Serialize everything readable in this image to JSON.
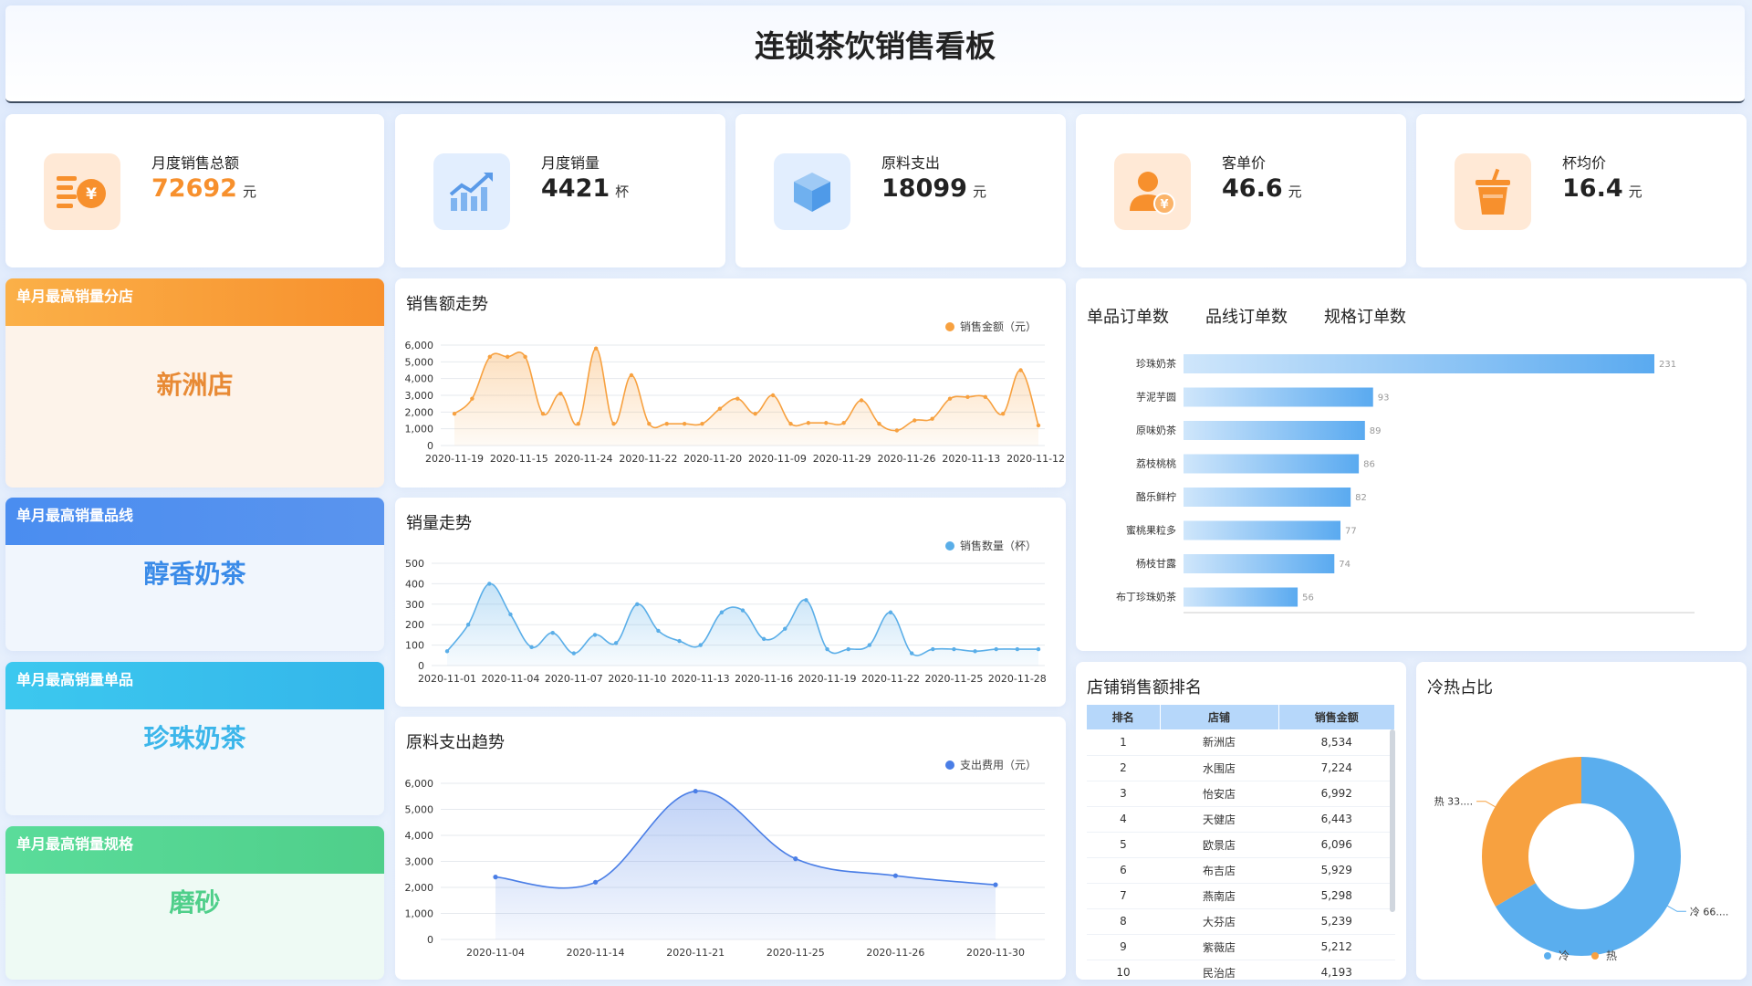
{
  "title": "连锁茶饮销售看板",
  "kpis": [
    {
      "label": "月度销售总额",
      "value": "72692",
      "unit": "元",
      "icon": "money-stack-icon",
      "color": "#f7902d"
    },
    {
      "label": "月度销量",
      "value": "4421",
      "unit": "杯",
      "icon": "chart-growth-icon",
      "color": "#5aa0ef"
    },
    {
      "label": "原料支出",
      "value": "18099",
      "unit": "元",
      "icon": "box-icon",
      "color": "#5aa0ef"
    },
    {
      "label": "客单价",
      "value": "46.6",
      "unit": "元",
      "icon": "customer-yuan-icon",
      "color": "#f7902d"
    },
    {
      "label": "杯均价",
      "value": "16.4",
      "unit": "元",
      "icon": "cup-icon",
      "color": "#f7902d"
    }
  ],
  "highlights": [
    {
      "label": "单月最高销量分店",
      "value": "新洲店",
      "color": "#f7902d"
    },
    {
      "label": "单月最高销量品线",
      "value": "醇香奶茶",
      "color": "#3a8be8"
    },
    {
      "label": "单月最高销量单品",
      "value": "珍珠奶茶",
      "color": "#3cb6ea"
    },
    {
      "label": "单月最高销量规格",
      "value": "磨砂",
      "color": "#4fcf8a"
    }
  ],
  "charts": {
    "sales_amount": {
      "title": "销售额走势",
      "legend": "销售金额（元）"
    },
    "sales_volume": {
      "title": "销量走势",
      "legend": "销售数量（杯）"
    },
    "material_cost": {
      "title": "原料支出趋势",
      "legend": "支出费用（元）"
    },
    "orders": {
      "tabs": [
        "单品订单数",
        "品线订单数",
        "规格订单数"
      ]
    },
    "store_rank": {
      "title": "店铺销售额排名",
      "headers": [
        "排名",
        "店铺",
        "销售金额"
      ]
    },
    "hot_cold": {
      "title": "冷热占比",
      "labels": {
        "hot": "热 33....",
        "cold": "冷 66...."
      },
      "legend": [
        "冷",
        "热"
      ]
    }
  },
  "chart_data": [
    {
      "type": "area",
      "title": "销售额走势",
      "series": [
        {
          "name": "销售金额（元）",
          "color": "#f7a140",
          "values": [
            1900,
            2800,
            5300,
            5300,
            5300,
            1900,
            3100,
            1300,
            5800,
            1300,
            4200,
            1300,
            1300,
            1300,
            1300,
            2200,
            2800,
            1900,
            3000,
            1300,
            1350,
            1350,
            1350,
            2700,
            1300,
            900,
            1500,
            1600,
            2800,
            2900,
            2900,
            1900,
            4500,
            1200
          ]
        }
      ],
      "x_ticks": [
        "2020-11-19",
        "2020-11-15",
        "2020-11-24",
        "2020-11-22",
        "2020-11-20",
        "2020-11-09",
        "2020-11-29",
        "2020-11-26",
        "2020-11-13",
        "2020-11-12"
      ],
      "y_ticks": [
        "6,000",
        "5,000",
        "4,000",
        "3,000",
        "2,000",
        "1,000",
        "0"
      ],
      "ylim": [
        0,
        6000
      ]
    },
    {
      "type": "area",
      "title": "销量走势",
      "series": [
        {
          "name": "销售数量（杯）",
          "color": "#5aaee8",
          "values": [
            70,
            200,
            400,
            250,
            90,
            160,
            60,
            150,
            110,
            300,
            170,
            120,
            100,
            260,
            270,
            130,
            180,
            320,
            80,
            80,
            100,
            260,
            60,
            80,
            80,
            70,
            80,
            80,
            80
          ]
        }
      ],
      "x_ticks": [
        "2020-11-01",
        "2020-11-04",
        "2020-11-07",
        "2020-11-10",
        "2020-11-13",
        "2020-11-16",
        "2020-11-19",
        "2020-11-22",
        "2020-11-25",
        "2020-11-28"
      ],
      "y_ticks": [
        "500",
        "400",
        "300",
        "200",
        "100",
        "0"
      ],
      "ylim": [
        0,
        500
      ]
    },
    {
      "type": "area",
      "title": "原料支出趋势",
      "categories": [
        "2020-11-04",
        "2020-11-14",
        "2020-11-21",
        "2020-11-25",
        "2020-11-26",
        "2020-11-30"
      ],
      "series": [
        {
          "name": "支出费用（元）",
          "color": "#4a7ee6",
          "values": [
            2400,
            2200,
            5700,
            3100,
            2450,
            2100
          ]
        }
      ],
      "y_ticks": [
        "6,000",
        "5,000",
        "4,000",
        "3,000",
        "2,000",
        "1,000",
        "0"
      ],
      "ylim": [
        0,
        6000
      ]
    },
    {
      "type": "bar",
      "title": "单品订单数",
      "categories": [
        "珍珠奶茶",
        "芋泥芋圆",
        "原味奶茶",
        "荔枝桃桃",
        "酪乐鲜柠",
        "蜜桃果粒多",
        "杨枝甘露",
        "布丁珍珠奶茶"
      ],
      "values": [
        231,
        93,
        89,
        86,
        82,
        77,
        74,
        56
      ],
      "xlim": [
        0,
        250
      ]
    },
    {
      "type": "table",
      "title": "店铺销售额排名",
      "headers": [
        "排名",
        "店铺",
        "销售金额"
      ],
      "rows": [
        [
          "1",
          "新洲店",
          "8,534"
        ],
        [
          "2",
          "水围店",
          "7,224"
        ],
        [
          "3",
          "怡安店",
          "6,992"
        ],
        [
          "4",
          "天健店",
          "6,443"
        ],
        [
          "5",
          "欧景店",
          "6,096"
        ],
        [
          "6",
          "布吉店",
          "5,929"
        ],
        [
          "7",
          "燕南店",
          "5,298"
        ],
        [
          "8",
          "大芬店",
          "5,239"
        ],
        [
          "9",
          "紫薇店",
          "5,212"
        ],
        [
          "10",
          "民治店",
          "4,193"
        ]
      ]
    },
    {
      "type": "pie",
      "title": "冷热占比",
      "categories": [
        "冷",
        "热"
      ],
      "values": [
        66.6,
        33.4
      ],
      "colors": [
        "#5aaeee",
        "#f7a140"
      ]
    }
  ]
}
